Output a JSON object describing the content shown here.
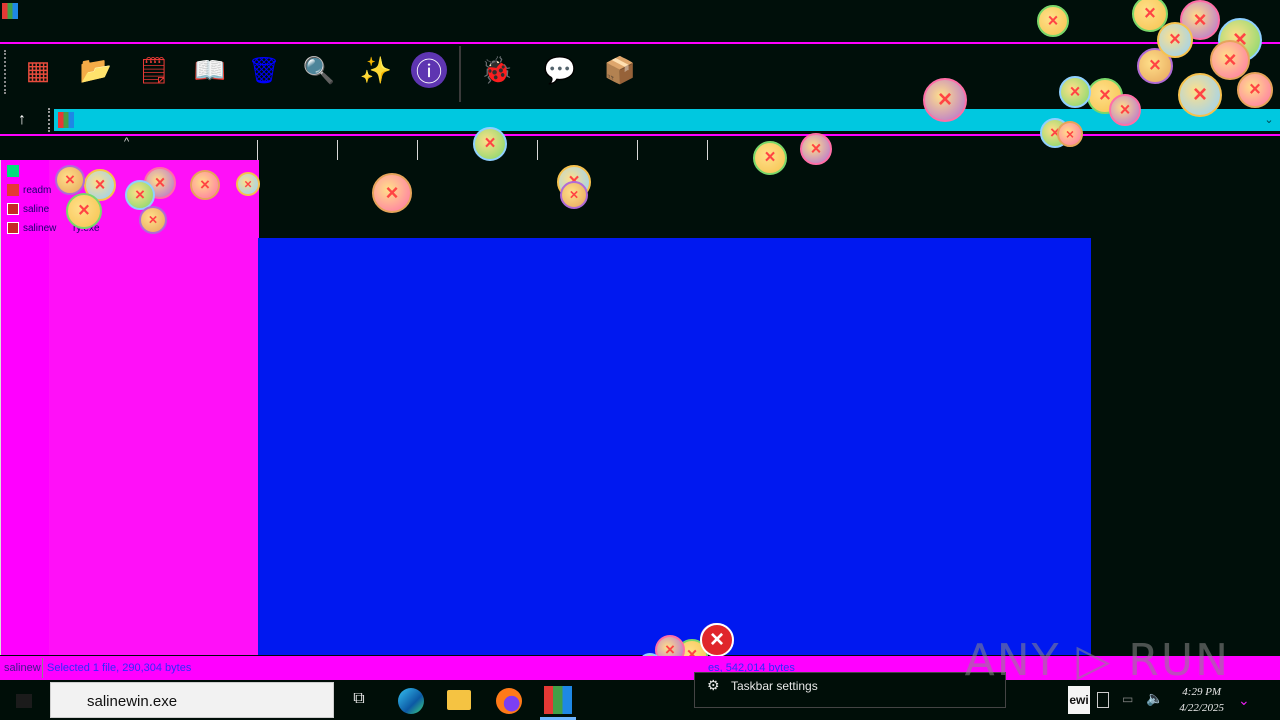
{
  "window": {
    "title": ""
  },
  "toolbar": {
    "buttons": [
      {
        "name": "add-icon",
        "glyph": "▦",
        "color": "#e84c3d"
      },
      {
        "name": "extract-icon",
        "glyph": "📂",
        "color": "#4caf50"
      },
      {
        "name": "test-icon",
        "glyph": "🗒",
        "color": "#e53935"
      },
      {
        "name": "view-icon",
        "glyph": "📖",
        "color": "#c62828"
      },
      {
        "name": "delete-icon",
        "glyph": "🗑",
        "color": "#90a4ae"
      },
      {
        "name": "find-icon",
        "glyph": "🔍",
        "color": "#42a5f5"
      },
      {
        "name": "wizard-icon",
        "glyph": "✨",
        "color": "#cfd8dc"
      },
      {
        "name": "info-icon",
        "glyph": "ⓘ",
        "color": "#5e35b1"
      },
      {
        "name": "virusscan-icon",
        "glyph": "🐞",
        "color": "#2e7d32"
      },
      {
        "name": "comment-icon",
        "glyph": "💬",
        "color": "#90caf9"
      },
      {
        "name": "sfx-icon",
        "glyph": "📦",
        "color": "#1565c0"
      }
    ]
  },
  "files": [
    {
      "label": "readm",
      "icon_color": "#e53935"
    },
    {
      "label": "saline",
      "icon_color": "#c62828"
    },
    {
      "label": "salinew      ry.exe",
      "icon_color": "#c62828"
    }
  ],
  "status": {
    "left_text": "salinew",
    "selected_text": "Selected 1 file, 290,304 bytes",
    "right_text": "es, 542,014 bytes"
  },
  "taskbar": {
    "search_value": "salinewin.exe",
    "settings_label": "Taskbar settings",
    "tray_app_label": "ewi",
    "clock_time": "4:29 PM",
    "clock_date": "4/22/2025"
  },
  "watermark": "ANY ▷ RUN",
  "colors": {
    "accent_magenta": "#ff00ff",
    "address_cyan": "#00c8e0",
    "panel_blue": "#0018f0"
  }
}
